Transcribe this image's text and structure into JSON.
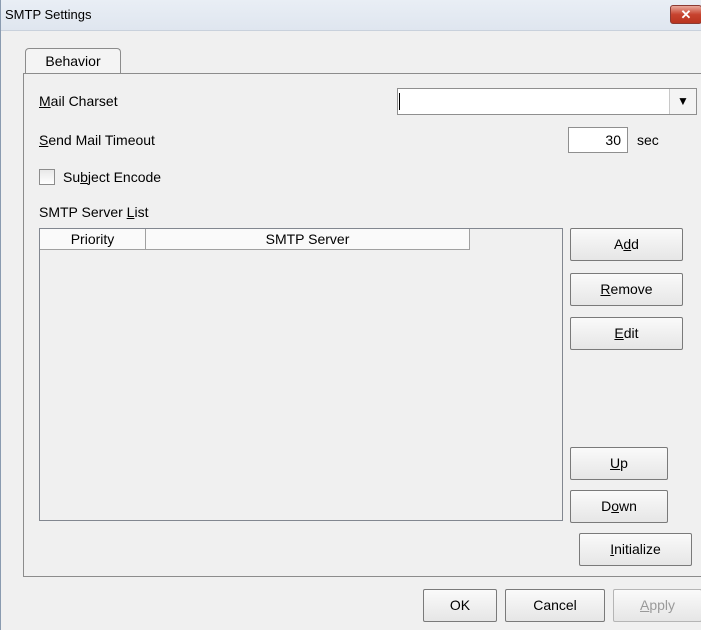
{
  "window": {
    "title": "SMTP Settings",
    "close_glyph": "✕"
  },
  "tabs": [
    {
      "label": "Behavior"
    }
  ],
  "fields": {
    "mail_charset": {
      "pre": "",
      "mn": "M",
      "post": "ail Charset",
      "value": ""
    },
    "send_mail_timeout": {
      "pre": "",
      "mn": "S",
      "post": "end Mail Timeout",
      "value": "30",
      "unit": "sec"
    },
    "subject_encode": {
      "pre": "Su",
      "mn": "b",
      "post": "ject Encode",
      "checked": false
    }
  },
  "server_list": {
    "label_pre": "SMTP Server ",
    "label_mn": "L",
    "label_post": "ist",
    "columns": [
      "Priority",
      "SMTP Server"
    ],
    "rows": []
  },
  "side_buttons": {
    "add": {
      "pre": "A",
      "mn": "d",
      "post": "d"
    },
    "remove": {
      "pre": "",
      "mn": "R",
      "post": "emove"
    },
    "edit": {
      "pre": "",
      "mn": "E",
      "post": "dit"
    },
    "up": {
      "pre": "",
      "mn": "U",
      "post": "p"
    },
    "down": {
      "pre": "D",
      "mn": "o",
      "post": "wn"
    },
    "initialize": {
      "pre": "",
      "mn": "I",
      "post": "nitialize"
    }
  },
  "footer": {
    "ok": "OK",
    "cancel": "Cancel",
    "apply": {
      "pre": "",
      "mn": "A",
      "post": "pply",
      "enabled": false
    }
  }
}
